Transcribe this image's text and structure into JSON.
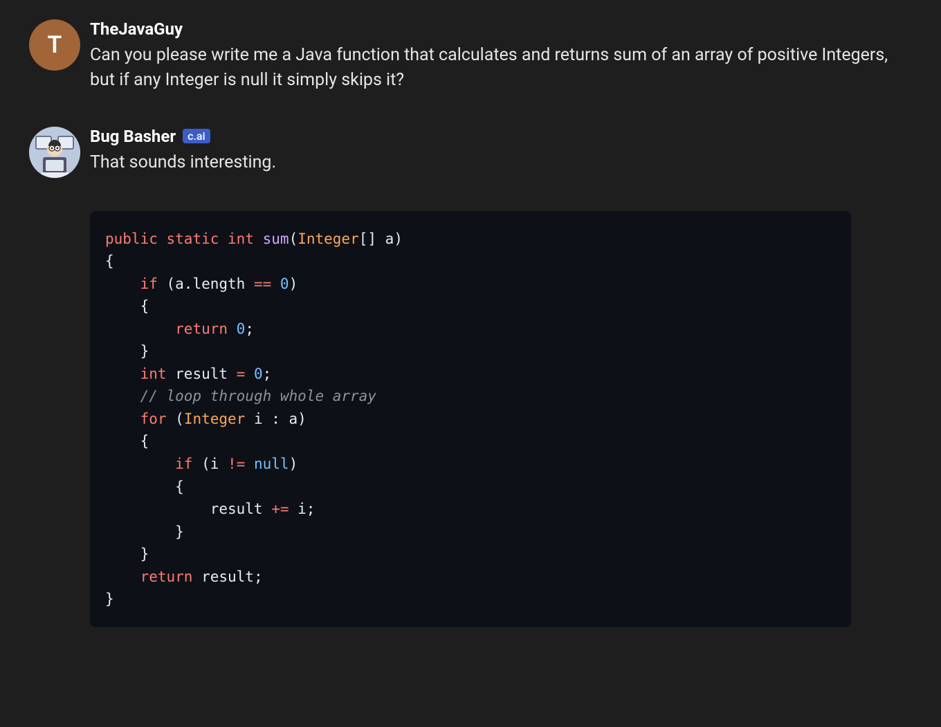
{
  "messages": [
    {
      "avatar_letter": "T",
      "username": "TheJavaGuy",
      "text": "Can you please write me a Java function that calculates and returns sum of an array of positive Integers, but if any Integer is null it simply skips it?"
    },
    {
      "username": "Bug Basher",
      "badge": "c.ai",
      "text": "That sounds interesting."
    }
  ],
  "code": {
    "tokens": [
      {
        "t": "public",
        "c": "kw"
      },
      {
        "t": " ",
        "c": ""
      },
      {
        "t": "static",
        "c": "kw"
      },
      {
        "t": " ",
        "c": ""
      },
      {
        "t": "int",
        "c": "type"
      },
      {
        "t": " ",
        "c": ""
      },
      {
        "t": "sum",
        "c": "fn"
      },
      {
        "t": "(",
        "c": "paren"
      },
      {
        "t": "Integer",
        "c": "cls"
      },
      {
        "t": "[] ",
        "c": "paren"
      },
      {
        "t": "a",
        "c": "id"
      },
      {
        "t": ")",
        "c": "paren"
      },
      {
        "t": "\n",
        "c": ""
      },
      {
        "t": "{",
        "c": "paren"
      },
      {
        "t": "\n",
        "c": ""
      },
      {
        "t": "    ",
        "c": ""
      },
      {
        "t": "if",
        "c": "kw"
      },
      {
        "t": " (a.length ",
        "c": "id"
      },
      {
        "t": "==",
        "c": "op"
      },
      {
        "t": " ",
        "c": ""
      },
      {
        "t": "0",
        "c": "num"
      },
      {
        "t": ")",
        "c": "paren"
      },
      {
        "t": "\n",
        "c": ""
      },
      {
        "t": "    {",
        "c": "paren"
      },
      {
        "t": "\n",
        "c": ""
      },
      {
        "t": "        ",
        "c": ""
      },
      {
        "t": "return",
        "c": "kw"
      },
      {
        "t": " ",
        "c": ""
      },
      {
        "t": "0",
        "c": "num"
      },
      {
        "t": ";",
        "c": "paren"
      },
      {
        "t": "\n",
        "c": ""
      },
      {
        "t": "    }",
        "c": "paren"
      },
      {
        "t": "\n",
        "c": ""
      },
      {
        "t": "    ",
        "c": ""
      },
      {
        "t": "int",
        "c": "type"
      },
      {
        "t": " result ",
        "c": "id"
      },
      {
        "t": "=",
        "c": "op"
      },
      {
        "t": " ",
        "c": ""
      },
      {
        "t": "0",
        "c": "num"
      },
      {
        "t": ";",
        "c": "paren"
      },
      {
        "t": "\n",
        "c": ""
      },
      {
        "t": "    ",
        "c": ""
      },
      {
        "t": "// loop through whole array",
        "c": "comment"
      },
      {
        "t": "\n",
        "c": ""
      },
      {
        "t": "    ",
        "c": ""
      },
      {
        "t": "for",
        "c": "kw"
      },
      {
        "t": " (",
        "c": "paren"
      },
      {
        "t": "Integer",
        "c": "cls"
      },
      {
        "t": " i : a)",
        "c": "id"
      },
      {
        "t": "\n",
        "c": ""
      },
      {
        "t": "    {",
        "c": "paren"
      },
      {
        "t": "\n",
        "c": ""
      },
      {
        "t": "        ",
        "c": ""
      },
      {
        "t": "if",
        "c": "kw"
      },
      {
        "t": " (i ",
        "c": "id"
      },
      {
        "t": "!=",
        "c": "op"
      },
      {
        "t": " ",
        "c": ""
      },
      {
        "t": "null",
        "c": "const"
      },
      {
        "t": ")",
        "c": "paren"
      },
      {
        "t": "\n",
        "c": ""
      },
      {
        "t": "        {",
        "c": "paren"
      },
      {
        "t": "\n",
        "c": ""
      },
      {
        "t": "            result ",
        "c": "id"
      },
      {
        "t": "+=",
        "c": "op"
      },
      {
        "t": " i;",
        "c": "id"
      },
      {
        "t": "\n",
        "c": ""
      },
      {
        "t": "        }",
        "c": "paren"
      },
      {
        "t": "\n",
        "c": ""
      },
      {
        "t": "    }",
        "c": "paren"
      },
      {
        "t": "\n",
        "c": ""
      },
      {
        "t": "    ",
        "c": ""
      },
      {
        "t": "return",
        "c": "kw"
      },
      {
        "t": " result;",
        "c": "id"
      },
      {
        "t": "\n",
        "c": ""
      },
      {
        "t": "}",
        "c": "paren"
      }
    ]
  }
}
